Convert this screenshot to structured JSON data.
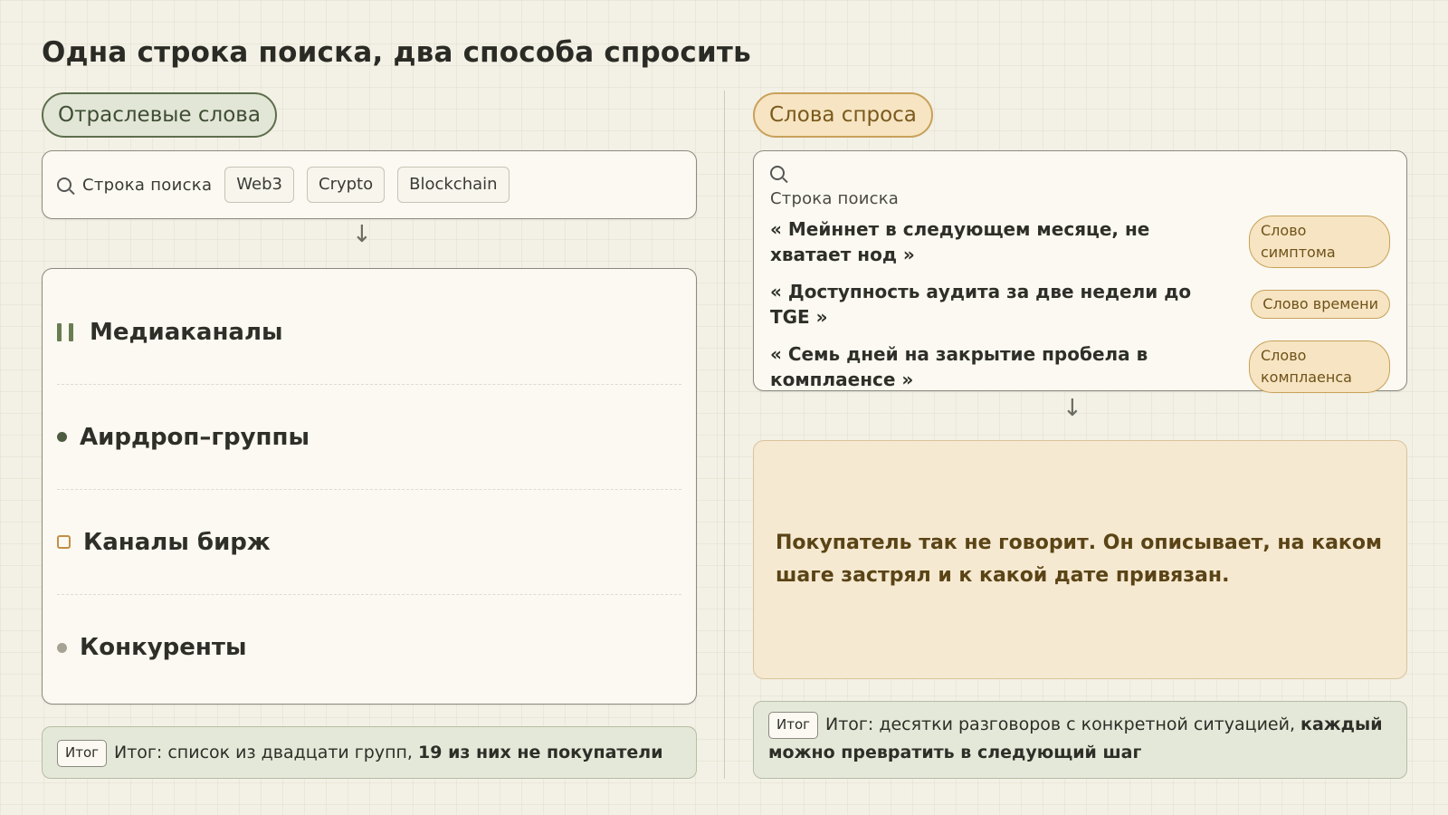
{
  "title": "Одна строка поиска, два способа спросить",
  "left": {
    "pill": "Отраслевые слова",
    "search_label": "Строка поиска",
    "chips": [
      "Web3",
      "Crypto",
      "Blockchain"
    ],
    "arrow": "↓",
    "items": [
      "Медиаканалы",
      "Аирдроп–группы",
      "Каналы бирж",
      "Конкуренты"
    ],
    "summary_tag": "Итог",
    "summary_text": "Итог: список из двадцати групп, ",
    "summary_bold": "19 из них не покупатели"
  },
  "right": {
    "pill": "Слова спроса",
    "search_label": "Строка поиска",
    "arrow": "↓",
    "queries": [
      {
        "text": "« Мейннет в следующем месяце, не хватает нод »",
        "tag": "Слово симптома"
      },
      {
        "text": "« Доступность аудита за две недели до TGE »",
        "tag": "Слово времени"
      },
      {
        "text": "« Семь дней на закрытие пробела в комплаенсе »",
        "tag": "Слово комплаенса"
      }
    ],
    "insight": "Покупатель так не говорит. Он описывает, на каком шаге застрял и к какой дате привязан.",
    "summary_tag": "Итог",
    "summary_text": "Итог: десятки разговоров с конкретной ситуацией, ",
    "summary_bold": "каждый можно превратить в следующий шаг"
  },
  "colors": {
    "background": "#f3f0e5",
    "green_accent": "#5d6e4c",
    "amber_accent": "#c8a15a",
    "insight_bg": "#f6e9d1"
  }
}
